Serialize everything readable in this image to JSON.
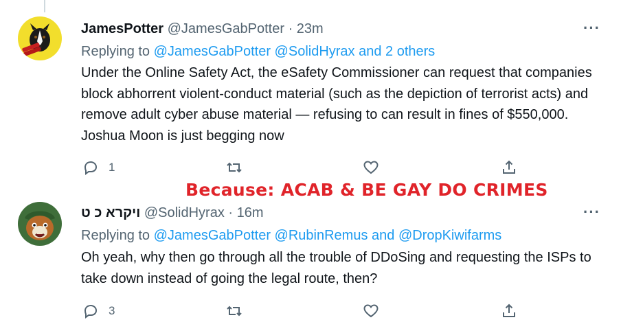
{
  "tweets": [
    {
      "name": "JamesPotter",
      "handle": "@JamesGabPotter",
      "dot": "·",
      "time": "23m",
      "replying_prefix": "Replying to ",
      "replying_links": "@JamesGabPotter @SolidHyrax and 2 others",
      "text": "Under the Online Safety Act, the eSafety Commissioner can request that companies block abhorrent violent-conduct material (such as the depiction of terrorist acts) and remove adult cyber abuse material — refusing to can result in fines of $550,000. Joshua Moon is just begging now",
      "reply_count": "1",
      "more": "···"
    },
    {
      "name": "ויקרא כ ט",
      "handle": "@SolidHyrax",
      "dot": "·",
      "time": "16m",
      "replying_prefix": "Replying to ",
      "replying_links": "@JamesGabPotter @RubinRemus and @DropKiwifarms",
      "text": "Oh yeah, why then go through all the trouble of DDoSing and requesting the ISPs to take down instead of going the legal route, then?",
      "reply_count": "3",
      "more": "···"
    }
  ],
  "overlay_text": "Because: ACAB & BE GAY DO CRIMES",
  "colors": {
    "link": "#1d9bf0",
    "overlay": "#e0242a",
    "secondary": "#536471"
  },
  "icons": [
    "reply-icon",
    "retweet-icon",
    "like-icon",
    "share-icon",
    "more-icon"
  ]
}
